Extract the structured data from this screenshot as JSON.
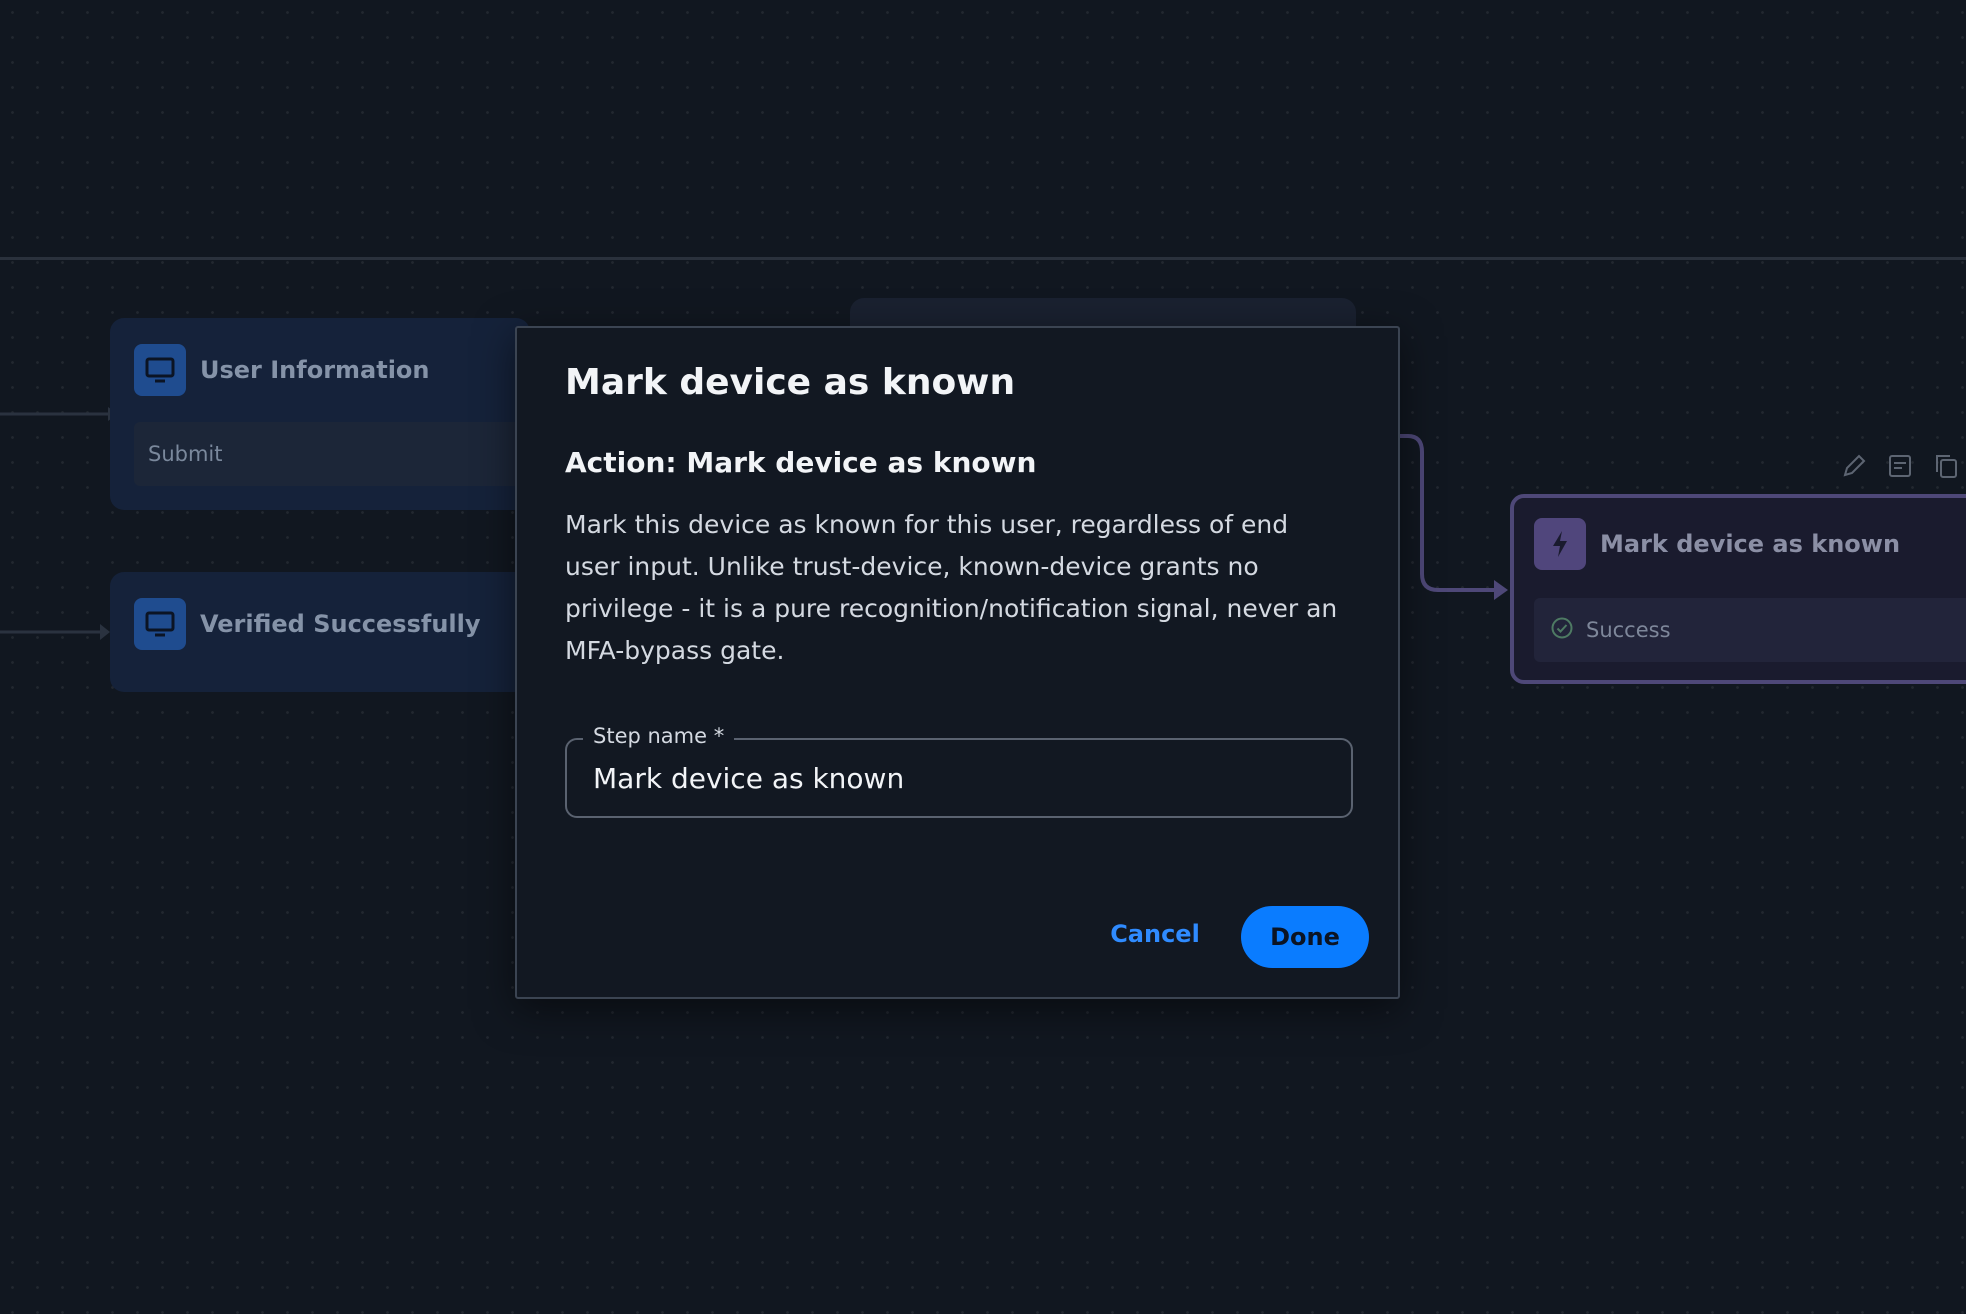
{
  "canvas": {
    "nodes": [
      {
        "title": "User Information",
        "row": "Submit",
        "icon": "monitor-icon"
      },
      {
        "title": "Verified Successfully",
        "icon": "monitor-icon"
      }
    ],
    "action_node": {
      "title": "Mark device as known",
      "icon": "lightning-icon",
      "status": "Success",
      "status_icon": "check-circle-icon"
    },
    "toolbar_icons": [
      "pencil-icon",
      "note-icon",
      "copy-icon"
    ]
  },
  "modal": {
    "title": "Mark device as known",
    "subtitle": "Action: Mark device as known",
    "description": "Mark this device as known for this user, regardless of end user input. Unlike trust-device, known-device grants no privilege - it is a pure recognition/notification signal, never an MFA-bypass gate.",
    "step_name_label": "Step name *",
    "step_name_value": "Mark device as known",
    "cancel_label": "Cancel",
    "done_label": "Done"
  },
  "colors": {
    "accent": "#0a7cff",
    "background": "#111720",
    "action_node_border": "#4e4878",
    "screen_icon_bg": "#1f4c8f"
  }
}
